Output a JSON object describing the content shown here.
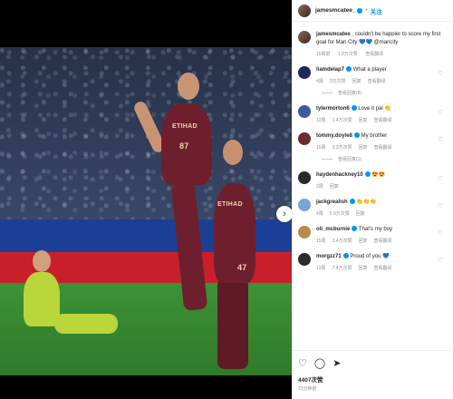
{
  "post": {
    "author": "jamesmcatee_",
    "follow_label": "关注",
    "caption_user": "jamesmcatee_",
    "caption_text": "couldn't be happier to score my first goal for Man City 💙💙 @mancity",
    "caption_time": "15周前",
    "caption_likes": "1.8万次赞",
    "caption_translate": "查看翻译"
  },
  "photo": {
    "sponsor_p1": "ETIHAD",
    "sponsor_p2": "ETIHAD",
    "number_p1": "87",
    "number_p2": "47"
  },
  "comments": [
    {
      "user": "liamdelap7",
      "text": "What a player",
      "time": "4周",
      "likes": "3万次赞",
      "reply": "回复",
      "translate": "查看翻译",
      "avatar_color": "#1d2b5a",
      "replies": "查看回复(8)"
    },
    {
      "user": "tylermorton6",
      "text": "Love it pal 👏",
      "time": "12周",
      "likes": "1.4万次赞",
      "reply": "回复",
      "translate": "查看翻译",
      "avatar_color": "#3d5a9b",
      "replies": ""
    },
    {
      "user": "tommy.doyle8",
      "text": "My brother",
      "time": "16周",
      "likes": "3.3万次赞",
      "reply": "回复",
      "translate": "查看翻译",
      "avatar_color": "#6b2c2c",
      "replies": "查看回复(1)"
    },
    {
      "user": "haydenhackney10",
      "text": "😍😍",
      "time": "2周",
      "likes": "",
      "reply": "回复",
      "translate": "",
      "avatar_color": "#2a2a2a",
      "replies": ""
    },
    {
      "user": "jackgrealish",
      "text": "👏👏👏",
      "time": "4周",
      "likes": "5.9万次赞",
      "reply": "回复",
      "translate": "",
      "avatar_color": "#7aa6d6",
      "replies": ""
    },
    {
      "user": "oli_mcburnie",
      "text": "That's my boy",
      "time": "15周",
      "likes": "3.4万次赞",
      "reply": "回复",
      "translate": "查看翻译",
      "avatar_color": "#b88a4a",
      "replies": ""
    },
    {
      "user": "morgzz71",
      "text": "Proud of you 💙",
      "time": "13周",
      "likes": "7.4万次赞",
      "reply": "回复",
      "translate": "查看翻译",
      "avatar_color": "#2b2b2b",
      "replies": ""
    }
  ],
  "footer": {
    "likes": "4407次赞",
    "date": "21分钟前"
  },
  "icons": {
    "like": "heart-icon",
    "comment": "comment-icon",
    "share": "share-icon",
    "next": "chevron-right-icon"
  }
}
